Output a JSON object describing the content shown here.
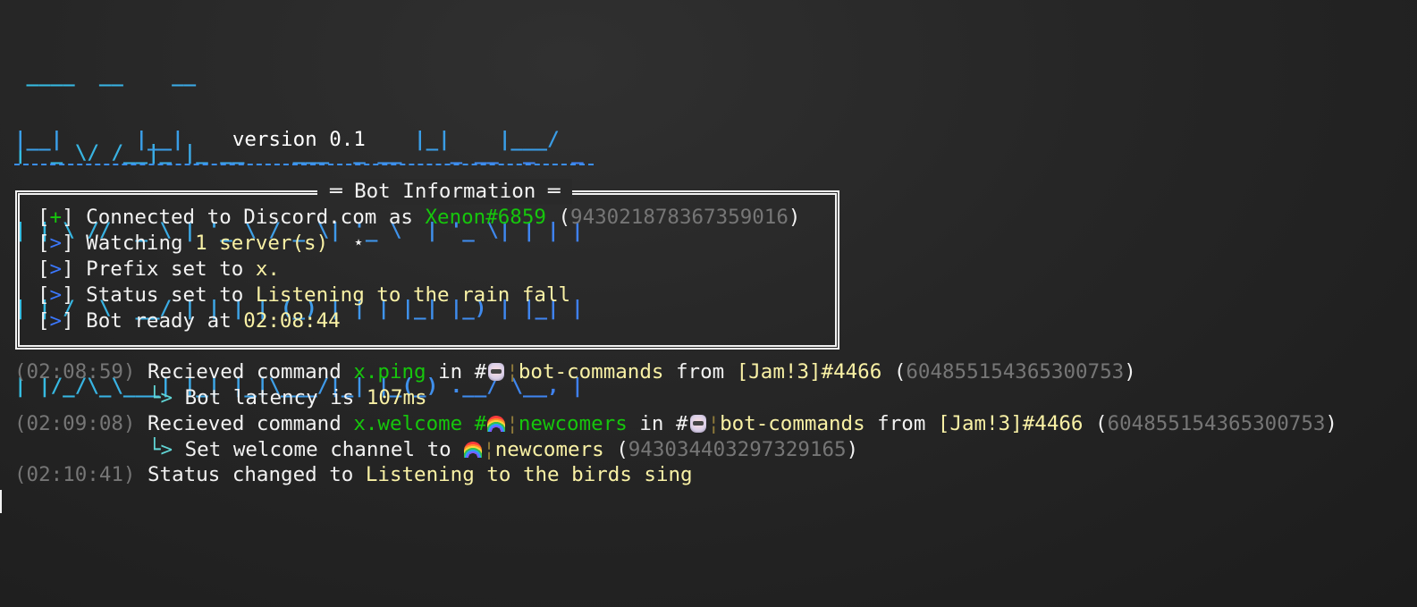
{
  "banner": {
    "lines": [
      " ____  __    __",
      "|  _ \\/ /__|_ |_ __    ___  _ __    _ __  _   _",
      "| | \\ //  _ \\ | '_ \\ / _ \\| '_ \\  | '_ \\| | | |",
      "| | /  \\  __/ | | | | (_) | | | |_| |_) | |_| |",
      "| |/_/\\_\\___| |_| |_|\\___/|_| |_(_) .__/ \\__, |"
    ],
    "left_base": "|__|",
    "mid_base": "|__|",
    "version": "version 0.1",
    "right_base_1": "|_|",
    "right_base_2": "|___/",
    "accent": "#3fa0e8"
  },
  "box": {
    "title": "Bot Information",
    "rows": [
      {
        "bracket": "[+]",
        "text": " Connected to Discord.com as ",
        "user": "Xenon#6859",
        "open": " (",
        "id": "943021878367359016",
        "close": ")"
      },
      {
        "bracket": "[>]",
        "text": " Watching ",
        "value": "1 server(s)",
        "extra": "  ⋆"
      },
      {
        "bracket": "[>]",
        "text": " Prefix set to ",
        "value": "x."
      },
      {
        "bracket": "[>]",
        "text": " Status set to ",
        "value": "Listening to the rain fall"
      },
      {
        "bracket": "[>]",
        "text": " Bot ready at ",
        "value": "02:08:44"
      }
    ]
  },
  "log": [
    {
      "time": "(02:08:59)",
      "pre": " Recieved command ",
      "cmd": "x.ping",
      "mid": " in #",
      "channel": "bot-commands",
      "from": " from ",
      "user": "[Jam!3]#4466",
      "open": " (",
      "id": "604855154365300753",
      "close": ")"
    },
    {
      "arrow": "└>",
      "text": " Bot latency is ",
      "value": "107ms"
    },
    {
      "time": "(02:09:08)",
      "pre": " Recieved command ",
      "cmd": "x.welcome #",
      "arg": "newcomers",
      "mid": " in #",
      "channel": "bot-commands",
      "from": " from ",
      "user": "[Jam!3]#4466",
      "open": " (",
      "id": "604855154365300753",
      "close": ")"
    },
    {
      "arrow": "└>",
      "text": " Set welcome channel to ",
      "value": "newcomers",
      "open": " (",
      "id": "943034403297329165",
      "close": ")"
    },
    {
      "time": "(02:10:41)",
      "pre": " Status changed to ",
      "value": "Listening to the birds sing"
    }
  ],
  "colors": {
    "green": "#16c60c",
    "yellow": "#f9f1a5",
    "gray": "#767676",
    "blue": "#3b78ff",
    "cyan": "#61d6d6"
  }
}
